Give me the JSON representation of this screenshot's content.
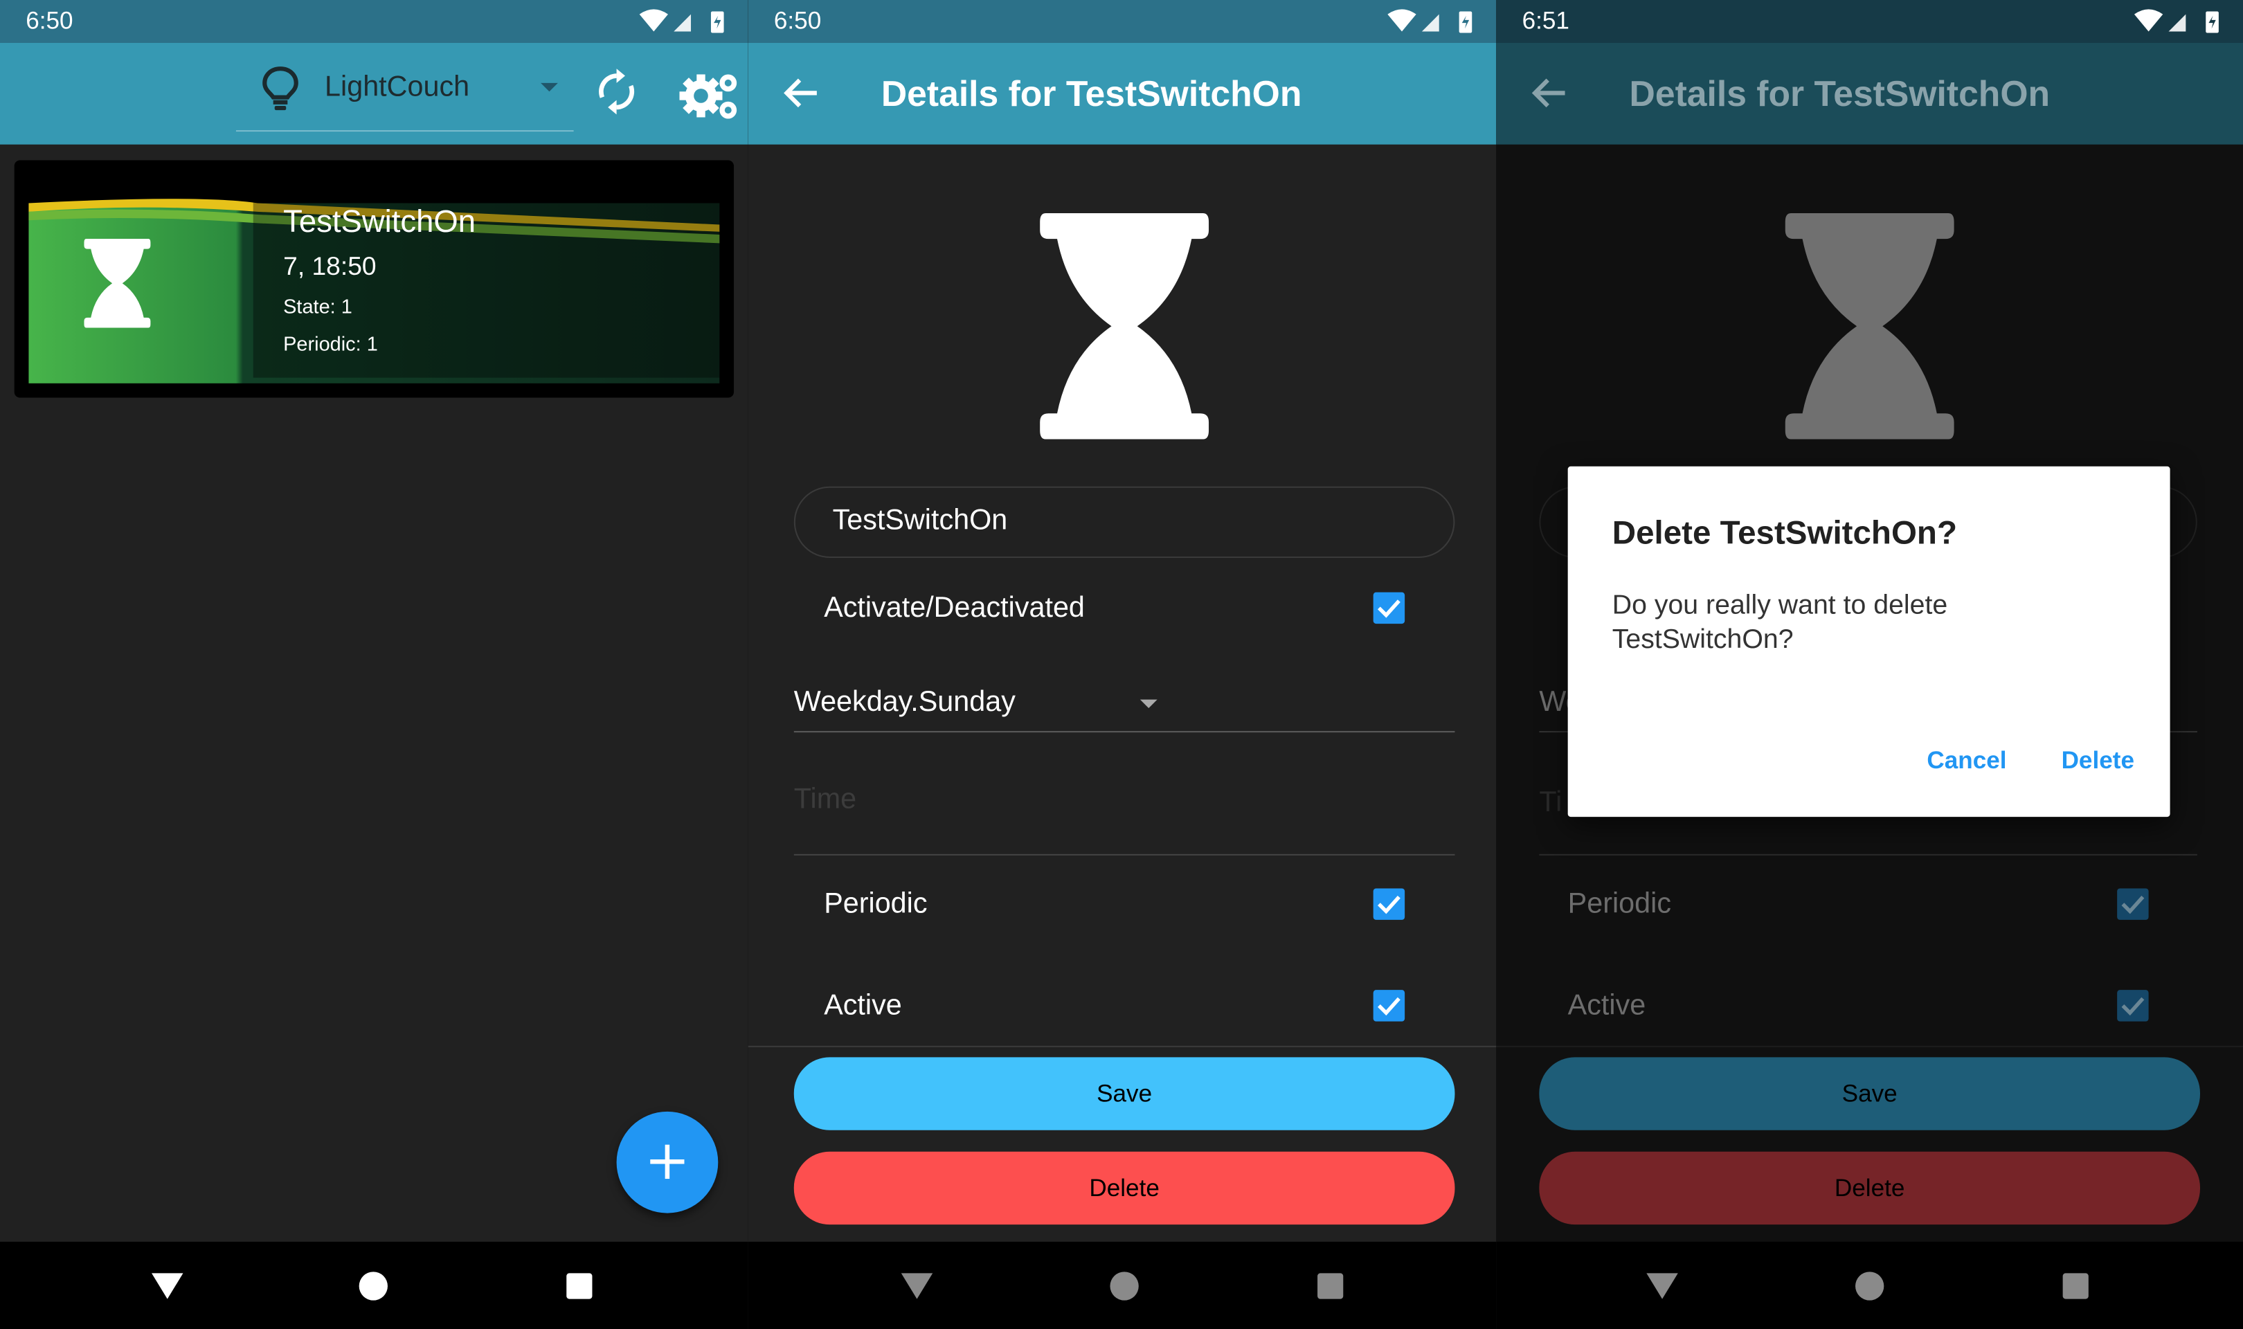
{
  "screen1": {
    "status_time": "6:50",
    "selector_label": "LightCouch",
    "card": {
      "name": "TestSwitchOn",
      "time": "7, 18:50",
      "state": "State: 1",
      "periodic": "Periodic: 1"
    },
    "fab_label": "+"
  },
  "screen2": {
    "status_time": "6:50",
    "title": "Details for TestSwitchOn",
    "name_value": "TestSwitchOn",
    "activate_label": "Activate/Deactivated",
    "activate_checked": true,
    "weekday_value": "Weekday.Sunday",
    "time_placeholder": "Time",
    "periodic_label": "Periodic",
    "periodic_checked": true,
    "active_label": "Active",
    "active_checked": true,
    "save_label": "Save",
    "delete_label": "Delete"
  },
  "screen3": {
    "status_time": "6:51",
    "title": "Details for TestSwitchOn",
    "weekday_partial": "We",
    "time_partial": "Ti",
    "periodic_label": "Periodic",
    "active_label": "Active",
    "save_label": "Save",
    "delete_label": "Delete",
    "dialog": {
      "title": "Delete TestSwitchOn?",
      "body": "Do you really want to delete TestSwitchOn?",
      "cancel_label": "Cancel",
      "delete_label": "Delete"
    }
  },
  "colors": {
    "appbar": "#3699b3",
    "statusbar": "#2c7189",
    "background": "#212121",
    "accent": "#2196f3",
    "save_button": "#42c2fc",
    "delete_button": "#fd4f4f"
  },
  "icons": {
    "wifi": "wifi-icon",
    "signal": "signal-icon",
    "battery": "battery-charging-icon",
    "bulb": "lightbulb-icon",
    "sync": "sync-icon",
    "settings": "gear-icon",
    "back": "back-arrow-icon",
    "timer": "hourglass-icon",
    "check": "checkbox-icon",
    "add": "add-icon",
    "nav_back": "nav-back-icon",
    "nav_home": "nav-home-icon",
    "nav_recents": "nav-recents-icon"
  }
}
